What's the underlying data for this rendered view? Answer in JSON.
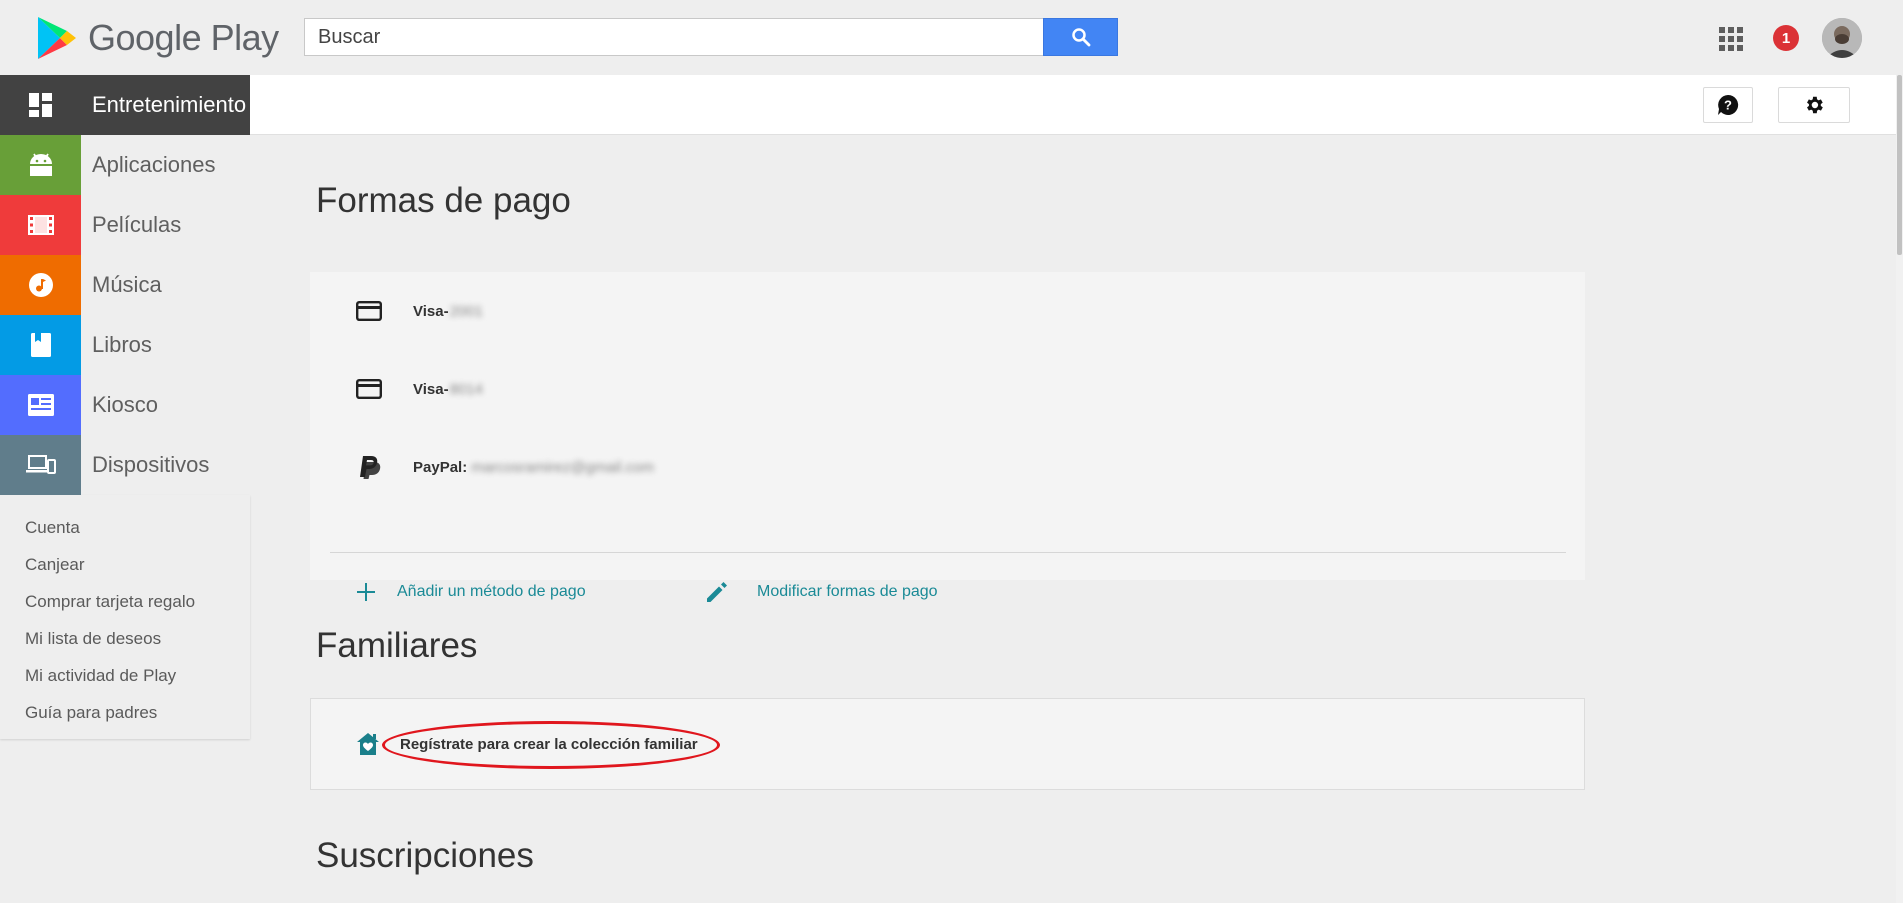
{
  "header": {
    "logo_text": "Google Play",
    "search_placeholder": "Buscar",
    "notification_count": "1"
  },
  "sidebar": {
    "categories": [
      {
        "label": "Entretenimiento",
        "color": "#424242",
        "icon": "grid-icon"
      },
      {
        "label": "Aplicaciones",
        "color": "#689f38",
        "icon": "android-icon"
      },
      {
        "label": "Películas",
        "color": "#ef3b3b",
        "icon": "film-icon"
      },
      {
        "label": "Música",
        "color": "#ef6c00",
        "icon": "music-note-icon"
      },
      {
        "label": "Libros",
        "color": "#039be5",
        "icon": "book-icon"
      },
      {
        "label": "Kiosco",
        "color": "#536dfe",
        "icon": "newspaper-icon"
      },
      {
        "label": "Dispositivos",
        "color": "#607d8b",
        "icon": "devices-icon"
      }
    ],
    "links": [
      "Cuenta",
      "Canjear",
      "Comprar tarjeta regalo",
      "Mi lista de deseos",
      "Mi actividad de Play",
      "Guía para padres"
    ]
  },
  "payment": {
    "title": "Formas de pago",
    "methods": [
      {
        "name": "Visa-",
        "masked": "2001",
        "icon": "credit-card-icon"
      },
      {
        "name": "Visa-",
        "masked": "8014",
        "icon": "credit-card-icon"
      },
      {
        "name": "PayPal:",
        "masked": "marcosramirez@gmail.com",
        "icon": "paypal-icon"
      }
    ],
    "add_label": "Añadir un método de pago",
    "edit_label": "Modificar formas de pago"
  },
  "family": {
    "title": "Familiares",
    "signup_label": "Regístrate para crear la colección familiar"
  },
  "subscriptions": {
    "title": "Suscripciones"
  },
  "colors": {
    "accent": "#1a8a96",
    "search_button": "#4285f4",
    "badge": "#db3236",
    "highlight_oval": "#e0161d"
  }
}
